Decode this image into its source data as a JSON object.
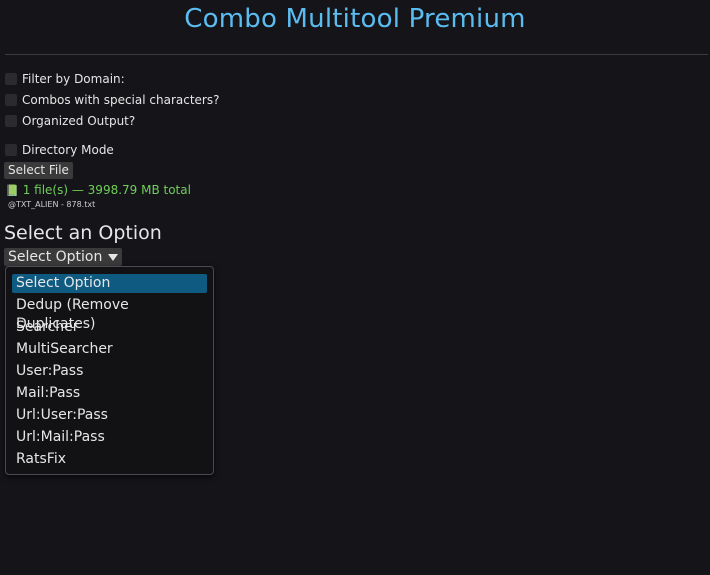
{
  "header": {
    "title": "Combo Multitool Premium"
  },
  "options": {
    "filter_domain": "Filter by Domain:",
    "special_chars": "Combos with special characters?",
    "organized_output": "Organized Output?",
    "directory_mode": "Directory Mode"
  },
  "file": {
    "select_label": "Select File",
    "icon": "green-book-icon",
    "summary": "1 file(s) — 3998.79 MB total",
    "name": "@TXT_ALIEN - 878.txt"
  },
  "selector": {
    "heading": "Select an Option",
    "current": "Select Option",
    "items": [
      "Select Option",
      "Dedup (Remove Duplicates)",
      "Searcher",
      "MultiSearcher",
      "User:Pass",
      "Mail:Pass",
      "Url:User:Pass",
      "Url:Mail:Pass",
      "RatsFix"
    ]
  },
  "colors": {
    "accent": "#5bbcf0",
    "success": "#6fcf5a",
    "selected": "#0f5a80",
    "background": "#141419"
  }
}
